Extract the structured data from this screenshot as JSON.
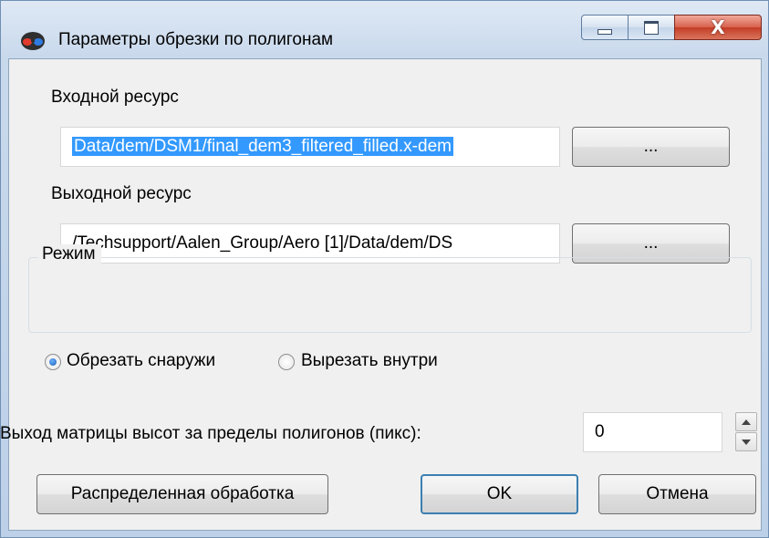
{
  "window": {
    "title": "Параметры обрезки по полигонам",
    "icon": "stereo-glasses-icon",
    "caption_buttons": {
      "close_label": "X"
    }
  },
  "input": {
    "label": "Входной ресурс",
    "value": "Data/dem/DSM1/final_dem3_filtered_filled.x-dem",
    "browse_label": "..."
  },
  "output": {
    "label": "Выходной ресурс",
    "value": "/Techsupport/Aalen_Group/Aero [1]/Data/dem/DS",
    "browse_label": "..."
  },
  "mode": {
    "title": "Режим",
    "options": [
      {
        "label": "Обрезать снаружи",
        "checked": true
      },
      {
        "label": "Вырезать внутри",
        "checked": false
      }
    ]
  },
  "overflow": {
    "label": "Выход матрицы высот за пределы полигонов (пикс):",
    "value": "0"
  },
  "buttons": {
    "distributed": "Распределенная обработка",
    "ok": "OK",
    "cancel": "Отмена"
  },
  "colors": {
    "selection": "#3399ff",
    "default_button_border": "#3c7fb1",
    "close_button": "#c43d26"
  }
}
